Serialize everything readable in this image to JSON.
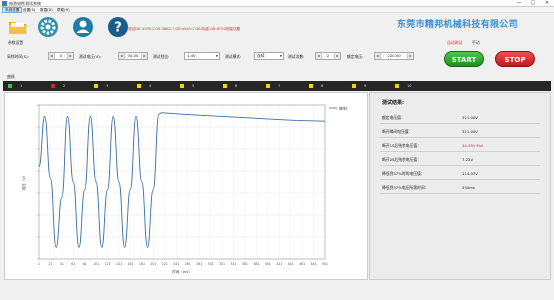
{
  "window": {
    "title": "电池电性测试系统",
    "minimize": "—",
    "maximize": "□",
    "close": "✕"
  },
  "menu": [
    "系统设置",
    "设置(S)",
    "数据(D)",
    "帮助(H)"
  ],
  "toolbar": {
    "icons": [
      "folder-icon",
      "gear-icon",
      "user-icon",
      "help-icon"
    ]
  },
  "note": "测试GB 4706.1 GB 3883.7 GB 4943.1 GB 标准 GB 8753测量试题",
  "company": "东莞市精邦机械科技有限公司",
  "tabs": {
    "settings": "参数设置",
    "test": "自动测试",
    "auto": "手动"
  },
  "params": {
    "sample_label": "采样时间(S):",
    "sample_value": "5",
    "voltage_label": "测试电压(V):",
    "voltage_value": "34.00",
    "range_label": "测试挡位:",
    "range_value": "1.4V",
    "mode_label": "测试模式:",
    "mode_value": "连续",
    "count_label": "测试次数:",
    "count_value": "2",
    "rated_label": "额定电压:",
    "rated_value": "220.00"
  },
  "buttons": {
    "start": "START",
    "stop": "STOP"
  },
  "curve_label": "曲线",
  "channels": [
    {
      "num": "1",
      "color": "#3cc83c"
    },
    {
      "num": "2",
      "color": "#e02020"
    },
    {
      "num": "3",
      "color": "#f2d410"
    },
    {
      "num": "4",
      "color": "#f2d410"
    },
    {
      "num": "5",
      "color": "#f2d410"
    },
    {
      "num": "6",
      "color": "#f2d410"
    },
    {
      "num": "7",
      "color": "#f2d410"
    },
    {
      "num": "8",
      "color": "#f2d410"
    },
    {
      "num": "9",
      "color": "#f2d410"
    },
    {
      "num": "10",
      "color": "#f2d410"
    }
  ],
  "chart_data": {
    "type": "line",
    "legend": "曲线1",
    "ylabel": "电压（V）",
    "xlabel": "时间（ms）",
    "x_ticks": [
      "1",
      "21",
      "41",
      "61",
      "81",
      "101",
      "121",
      "141",
      "161",
      "181",
      "201",
      "221",
      "241",
      "261",
      "281",
      "301",
      "321",
      "341",
      "361",
      "381",
      "401",
      "421",
      "441",
      "461",
      "481",
      "501"
    ],
    "y_ticks": [
      "",
      "",
      "",
      "",
      "",
      "",
      "",
      ""
    ],
    "series": [
      {
        "name": "曲线1",
        "x": [
          0,
          10,
          20,
          30,
          40,
          50,
          60,
          70,
          80,
          90,
          100,
          110,
          120,
          130,
          140,
          150,
          160,
          170,
          180,
          190,
          200,
          210,
          215,
          250,
          300,
          350,
          400,
          450,
          501
        ],
        "y": [
          0.2,
          0.85,
          0.05,
          -0.85,
          -0.2,
          0.85,
          0.0,
          -0.85,
          -0.1,
          0.85,
          0.0,
          -0.85,
          -0.1,
          0.85,
          0.0,
          -0.85,
          -0.1,
          0.85,
          0.0,
          -0.85,
          -0.1,
          0.88,
          0.9,
          0.88,
          0.86,
          0.84,
          0.82,
          0.8,
          0.79
        ]
      }
    ],
    "ylim": [
      -1,
      1
    ],
    "xlim": [
      0,
      501
    ]
  },
  "results": {
    "title": "测试结果:",
    "rows": [
      {
        "label": "额定电压值：",
        "value": "311.00V",
        "red": false
      },
      {
        "label": "断开瞬间电压值：",
        "value": "311.00V",
        "red": false
      },
      {
        "label": "断开1S后残余电压值：",
        "value": "44.55V  Fail",
        "red": true
      },
      {
        "label": "断开2S后残余电压值：",
        "value": "7.22V",
        "red": false
      },
      {
        "label": "降低到37%时的电压值：",
        "value": "114.07V",
        "red": false
      },
      {
        "label": "降低到37%电压所需时间：",
        "value": "534ms",
        "red": false
      }
    ]
  }
}
